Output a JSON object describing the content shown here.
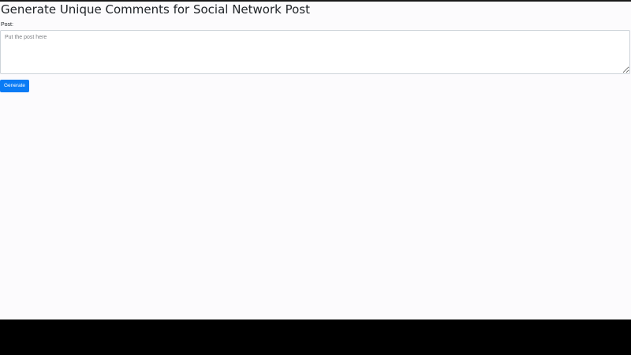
{
  "page": {
    "title": "Generate Unique Comments for Social Network Post"
  },
  "form": {
    "post_label": "Post:",
    "post_value": "",
    "post_placeholder": "Put the post here",
    "generate_label": "Generate"
  },
  "colors": {
    "primary_button": "#0a7bf5",
    "page_background": "#fcfbfd",
    "text": "#212529",
    "input_border": "#ced4da"
  }
}
